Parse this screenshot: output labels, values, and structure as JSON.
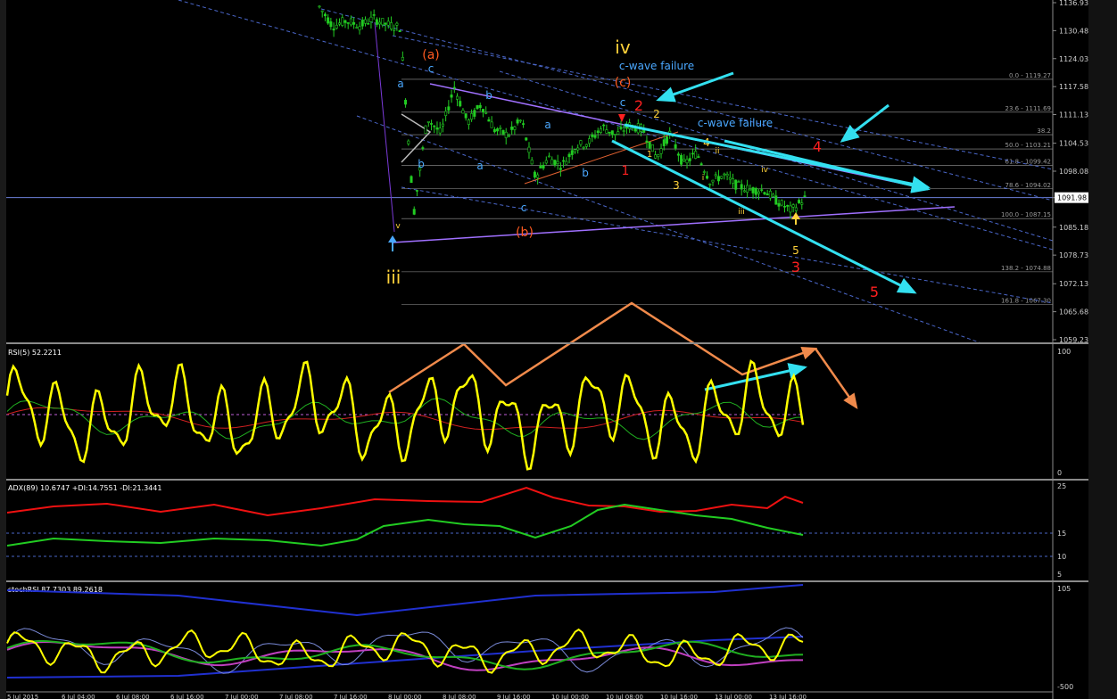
{
  "price_panel": {
    "price_axis_ticks": [
      "1136.93",
      "1130.48",
      "1124.03",
      "1117.58",
      "1111.13",
      "1104.53",
      "1098.08",
      "1091.98",
      "1085.18",
      "1078.73",
      "1072.13",
      "1065.68",
      "1059.23"
    ],
    "current_price": "1091.98",
    "fib_levels": [
      {
        "label": "0.0 - 1119.27"
      },
      {
        "label": "23.6 - 1111.69"
      },
      {
        "label": "38.2"
      },
      {
        "label": "50.0 - 1103.21"
      },
      {
        "label": "61.8 - 1099.42"
      },
      {
        "label": "78.6 - 1094.02"
      },
      {
        "label": "100.0 - 1087.15"
      },
      {
        "label": "138.2 - 1074.88"
      },
      {
        "label": "161.8 - 1067.30"
      }
    ],
    "annotations": {
      "iii": "iii",
      "iv": "iv",
      "a_paren": "(a)",
      "b_paren": "(b)",
      "c_paren": "(c)",
      "cwave_failure": "c-wave failure",
      "c_label": "c",
      "a_label": "a",
      "b_label": "b",
      "num1": "1",
      "num2": "2",
      "num3": "3",
      "num4": "4",
      "num5": "5",
      "small_i": "i",
      "small_ii": "ii",
      "small_iii": "iii",
      "small_iv": "iv",
      "small_v": "v"
    }
  },
  "indicators": {
    "rsi_label": "RSI(5) 52.2211",
    "rsi_axis": [
      "100",
      "0"
    ],
    "adx_label": "ADX(89) 10.6747 +DI:14.7551 -DI:21.3441",
    "adx_axis": [
      "25",
      "15",
      "10",
      "5"
    ],
    "stoch_label": "stochRSI 87.7303 89.2618",
    "stoch_axis": [
      "105",
      "-500"
    ]
  },
  "time_axis": [
    "5 Jul 2015",
    "6 Jul 04:00",
    "6 Jul 08:00",
    "6 Jul 16:00",
    "7 Jul 00:00",
    "7 Jul 08:00",
    "7 Jul 16:00",
    "8 Jul 00:00",
    "8 Jul 08:00",
    "9 Jul 16:00",
    "10 Jul 00:00",
    "10 Jul 08:00",
    "10 Jul 16:00",
    "13 Jul 00:00",
    "13 Jul 16:00"
  ],
  "colors": {
    "background": "#000000",
    "candle": "#22cc22",
    "cyan_arrow": "#33e0f0",
    "orange_arrow": "#f08a4b",
    "rsi_line": "#ffff00",
    "adx_plus": "#22cc22",
    "adx_minus": "#ee1111",
    "wave_red": "#ff2020",
    "wave_yellow": "#ffd23a",
    "wave_blue": "#4aa8ff",
    "fib": "#9a9a9a",
    "trend_purple": "#a070ff"
  },
  "chart_data": [
    {
      "type": "candlestick",
      "title": "",
      "ylim": [
        1059.23,
        1136.93
      ],
      "last_price": 1091.98,
      "fib_retracement": {
        "0.0": 1119.27,
        "23.6": 1111.69,
        "50.0": 1103.21,
        "61.8": 1099.42,
        "78.6": 1094.02,
        "100.0": 1087.15,
        "138.2": 1074.88,
        "161.8": 1067.3
      },
      "close_path": [
        1136.0,
        1131.5,
        1132.8,
        1131.6,
        1133.3,
        1131.9,
        1131.2,
        1088.4,
        1110.3,
        1106.8,
        1117.5,
        1109.2,
        1113.6,
        1107.6,
        1106.4,
        1110.0,
        1096.7,
        1101.3,
        1099.3,
        1103.8,
        1104.8,
        1108.3,
        1106.4,
        1108.6,
        1107.7,
        1101.2,
        1106.8,
        1099.6,
        1102.3,
        1095.7,
        1097.2,
        1094.7,
        1093.8,
        1093.7,
        1091.0,
        1089.0,
        1091.8
      ]
    },
    {
      "type": "line",
      "title": "RSI(5) 52.2211",
      "ylim": [
        0,
        100
      ],
      "last": 52.2211
    },
    {
      "type": "line",
      "title": "ADX(89) 10.6747 +DI:14.7551 -DI:21.3441",
      "series": [
        {
          "name": "ADX",
          "last": 10.6747
        },
        {
          "name": "+DI",
          "last": 14.7551
        },
        {
          "name": "-DI",
          "last": 21.3441
        }
      ]
    },
    {
      "type": "line",
      "title": "stochRSI 87.7303 89.2618",
      "series": [
        {
          "name": "stochRSI",
          "last": 87.7303
        },
        {
          "name": "signal",
          "last": 89.2618
        }
      ]
    }
  ]
}
